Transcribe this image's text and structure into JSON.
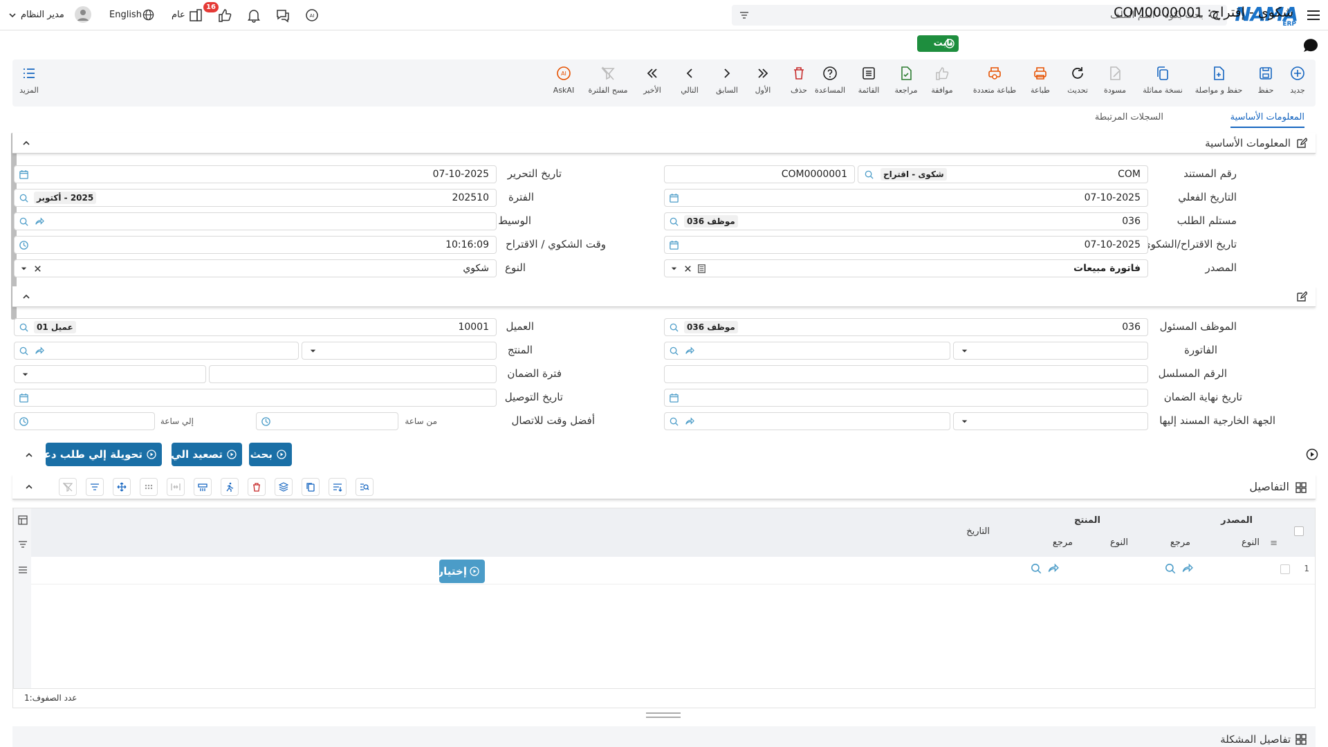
{
  "topbar": {
    "logo": "NAMA",
    "logo_sub": "ERP",
    "search_placeholder": "بحث بكود - اسم الملف",
    "user_name": "مدير النظام",
    "language": "English",
    "scope": "عام",
    "notification_count": "16"
  },
  "title": {
    "text": "شكوي - إقتراح: COM0000001",
    "status": "ثابت"
  },
  "toolbar": {
    "new": "جديد",
    "save": "حفظ",
    "save_continue": "حفظ و مواصلة",
    "duplicate": "نسخة مماثلة",
    "draft": "مسودة",
    "refresh": "تحديث",
    "print": "طباعة",
    "multi_print": "طباعة متعددة",
    "approve": "موافقة",
    "review": "مراجعة",
    "list": "القائمة",
    "help": "المساعدة",
    "delete": "حذف",
    "first": "الأول",
    "previous": "السابق",
    "next": "التالي",
    "last": "الأخير",
    "clear_filter": "مسح الفلترة",
    "ask_ai": "AskAI",
    "more": "المزيد"
  },
  "tabs": {
    "basic": "المعلومات الأساسية",
    "related": "السجلات المرتبطة"
  },
  "section1": {
    "title": "المعلومات الأساسية",
    "doc_no_label": "رقم المستند",
    "doc_no_prefix": "COM",
    "doc_type_tag": "شكوى - اقتراح",
    "doc_no_value": "COM0000001",
    "edit_date_label": "تاريخ التحرير",
    "edit_date": "07-10-2025",
    "actual_date_label": "التاريخ الفعلي",
    "actual_date": "07-10-2025",
    "period_label": "الفترة",
    "period": "202510",
    "period_tag": "2025 - أكتوبر",
    "receiver_label": "مستلم الطلب",
    "receiver_code": "036",
    "receiver_tag": "موظف 036",
    "broker_label": "الوسيط",
    "complaint_date_label": "تاريخ الاقتراح/الشكوي",
    "complaint_date": "07-10-2025",
    "complaint_time_label": "وقت الشكوي / الاقتراح",
    "complaint_time": "10:16:09",
    "source_label": "المصدر",
    "source": "فاتورة مبيعات",
    "type_label": "النوع",
    "type": "شكوي"
  },
  "section2": {
    "employee_label": "الموظف المسئول",
    "employee_code": "036",
    "employee_tag": "موظف 036",
    "customer_label": "العميل",
    "customer_code": "10001",
    "customer_tag": "عميل 01",
    "invoice_label": "الفاتورة",
    "product_label": "المنتج",
    "serial_label": "الرقم المسلسل",
    "warranty_period_label": "فترة الضمان",
    "warranty_end_label": "تاريخ نهاية الضمان",
    "delivery_date_label": "تاريخ التوصيل",
    "external_party_label": "الجهة الخارجية المسند إليها",
    "best_time_label": "أفضل وقت للاتصال",
    "from_time": "من ساعة",
    "to_time": "إلي ساعة"
  },
  "actions": {
    "search": "بحث",
    "escalate": "تصعيد الي",
    "convert": "تحويلة إلي طلب دعم"
  },
  "details": {
    "title": "التفاصيل",
    "col_source": "المصدر",
    "col_product": "المنتج",
    "col_type": "النوع",
    "col_ref": "مرجع",
    "col_date": "التاريخ",
    "row_no": "1",
    "select_btn": "إختيار",
    "row_count": "عدد الصفوف:1"
  },
  "bottom": {
    "title": "تفاصيل المشكلة"
  }
}
